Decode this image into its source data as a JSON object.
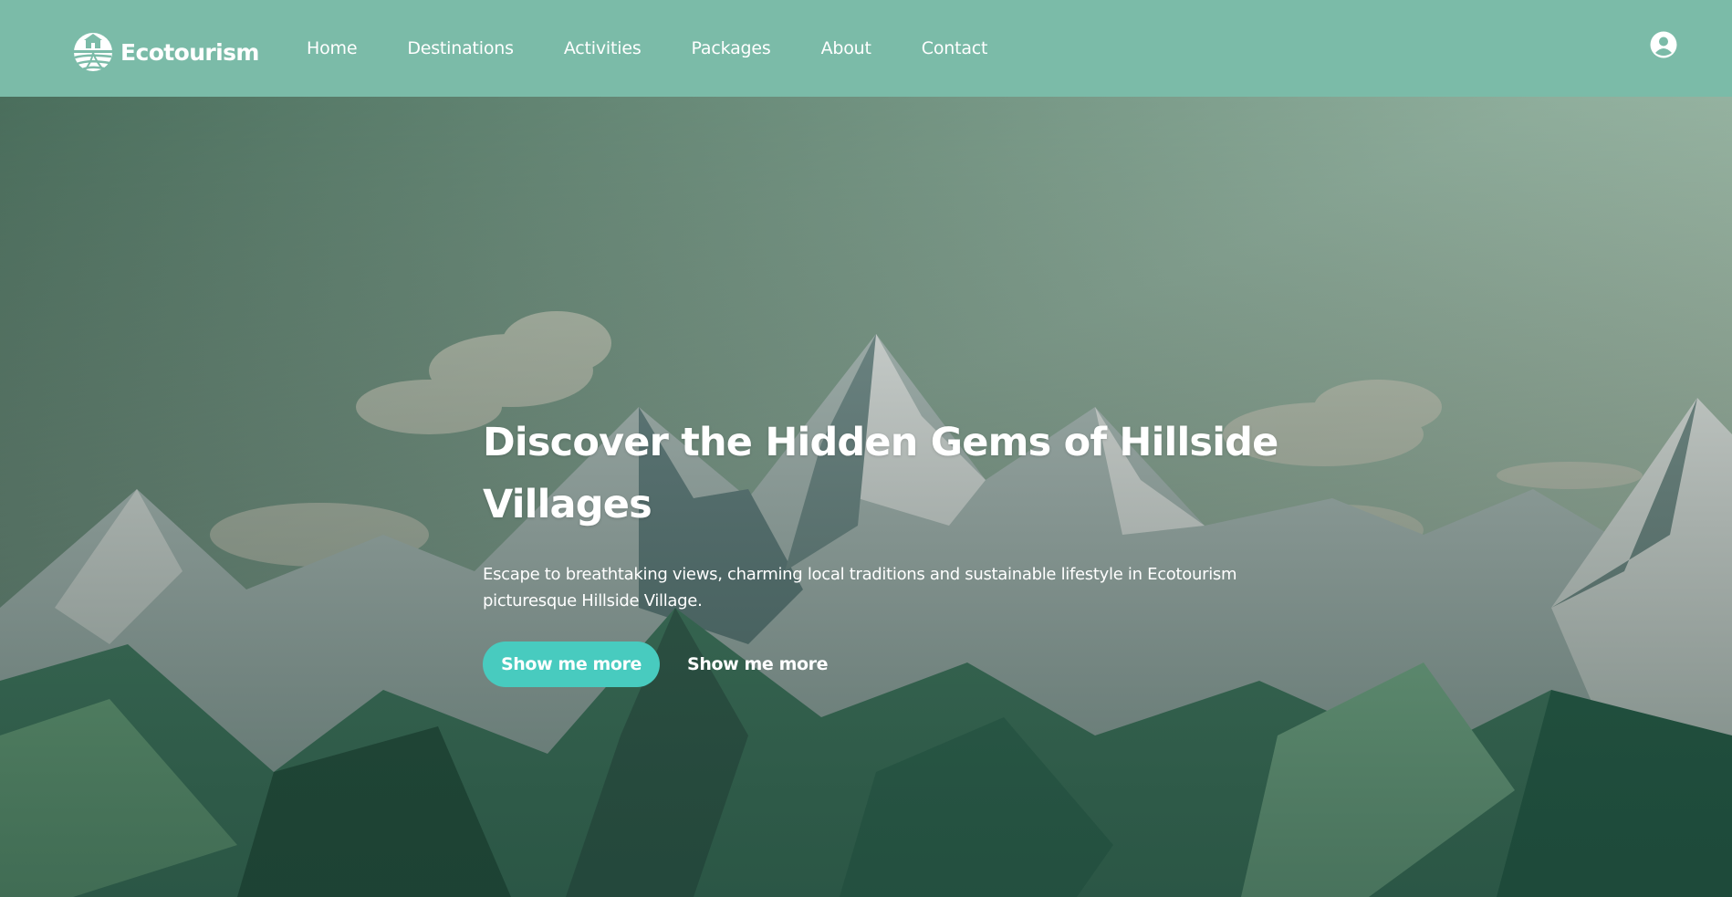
{
  "header": {
    "brand": "Ecotourism",
    "logo_icon": "village-sun-hills-logo",
    "account_icon": "user-circle-icon",
    "background_color": "#7bbba8"
  },
  "nav": {
    "items": [
      {
        "label": "Home"
      },
      {
        "label": "Destinations"
      },
      {
        "label": "Activities"
      },
      {
        "label": "Packages"
      },
      {
        "label": "About"
      },
      {
        "label": "Contact"
      }
    ]
  },
  "hero": {
    "title": "Discover the Hidden Gems of Hillside Villages",
    "subtitle": "Escape to breathtaking views, charming local traditions and sustainable lifestyle in Ecotourism picturesque Hillside Village.",
    "primary_button": "Show me more",
    "secondary_button": "Show me more",
    "accent_color": "#48cbbf",
    "background_image": "snowy-mountain-range-illustration"
  }
}
